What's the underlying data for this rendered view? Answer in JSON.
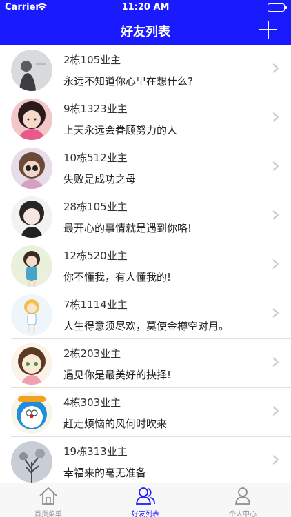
{
  "status_bar": {
    "carrier": "Carrier",
    "time": "11:20 AM"
  },
  "navbar": {
    "title": "好友列表"
  },
  "friends": [
    {
      "name": "2栋105业主",
      "message": "永远不知道你心里在想什么?"
    },
    {
      "name": "9栋1323业主",
      "message": "上天永远会眷顾努力的人"
    },
    {
      "name": "10栋512业主",
      "message": "失败是成功之母"
    },
    {
      "name": "28栋105业主",
      "message": "最开心的事情就是遇到你咯!"
    },
    {
      "name": "12栋520业主",
      "message": "你不懂我，有人懂我的!"
    },
    {
      "name": "7栋1114业主",
      "message": "人生得意须尽欢，莫使金樽空对月。"
    },
    {
      "name": "2栋203业主",
      "message": "遇见你是最美好的抉择!"
    },
    {
      "name": "4栋303业主",
      "message": "赶走烦恼的风何时吹来"
    },
    {
      "name": "19栋313业主",
      "message": "幸福来的毫无准备"
    }
  ],
  "tabs": [
    {
      "label": "首页菜单",
      "active": false
    },
    {
      "label": "好友列表",
      "active": true
    },
    {
      "label": "个人中心",
      "active": false
    }
  ],
  "colors": {
    "accent": "#1a1aff",
    "inactive_tab": "#8e8e93"
  }
}
